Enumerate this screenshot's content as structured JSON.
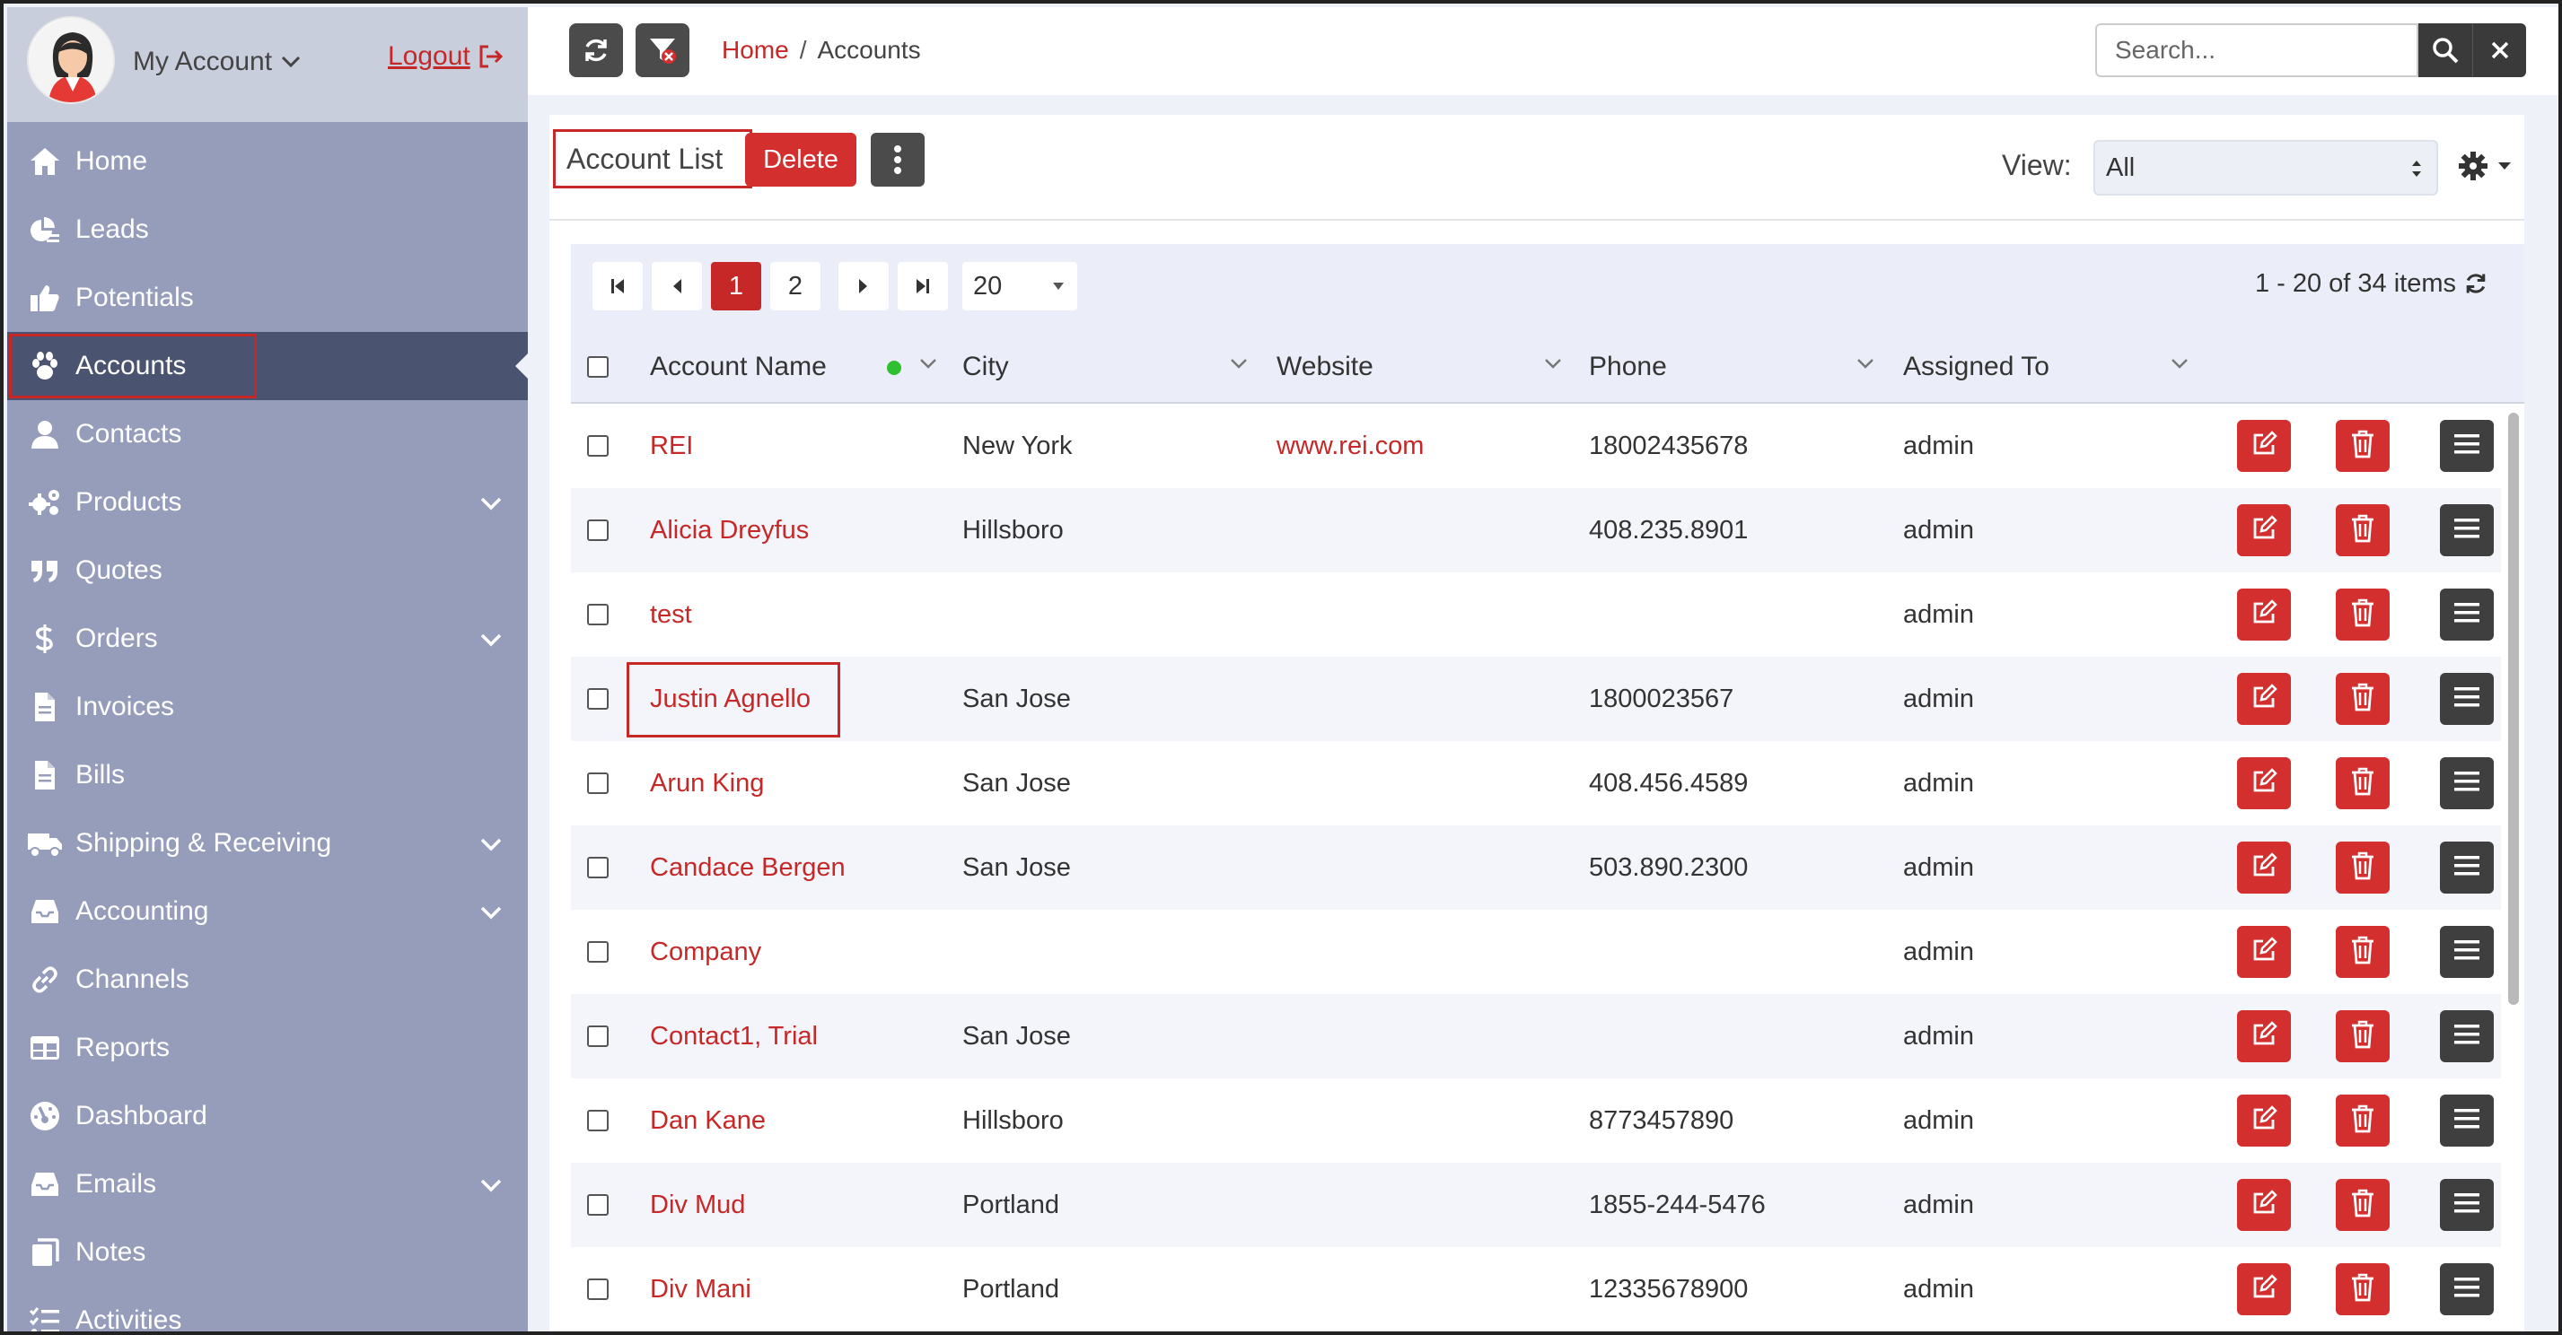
{
  "account_menu": {
    "label": "My Account",
    "logout": "Logout"
  },
  "sidebar": {
    "items": [
      {
        "label": "Home",
        "icon": "home-icon",
        "expandable": false
      },
      {
        "label": "Leads",
        "icon": "leads-icon",
        "expandable": false
      },
      {
        "label": "Potentials",
        "icon": "thumbs-up-icon",
        "expandable": false
      },
      {
        "label": "Accounts",
        "icon": "paw-icon",
        "expandable": false,
        "active": true
      },
      {
        "label": "Contacts",
        "icon": "user-icon",
        "expandable": false
      },
      {
        "label": "Products",
        "icon": "gears-icon",
        "expandable": true
      },
      {
        "label": "Quotes",
        "icon": "quote-icon",
        "expandable": false
      },
      {
        "label": "Orders",
        "icon": "dollar-icon",
        "expandable": true
      },
      {
        "label": "Invoices",
        "icon": "file-icon",
        "expandable": false
      },
      {
        "label": "Bills",
        "icon": "file-icon",
        "expandable": false
      },
      {
        "label": "Shipping & Receiving",
        "icon": "truck-icon",
        "expandable": true
      },
      {
        "label": "Accounting",
        "icon": "inbox-icon",
        "expandable": true
      },
      {
        "label": "Channels",
        "icon": "link-icon",
        "expandable": false
      },
      {
        "label": "Reports",
        "icon": "table-icon",
        "expandable": false
      },
      {
        "label": "Dashboard",
        "icon": "gauge-icon",
        "expandable": false
      },
      {
        "label": "Emails",
        "icon": "inbox-icon",
        "expandable": true
      },
      {
        "label": "Notes",
        "icon": "notes-icon",
        "expandable": false
      },
      {
        "label": "Activities",
        "icon": "tasks-icon",
        "expandable": false
      }
    ]
  },
  "topbar": {
    "breadcrumb_home": "Home",
    "breadcrumb_sep": "/",
    "breadcrumb_current": "Accounts",
    "search_placeholder": "Search...",
    "search_value": ""
  },
  "list": {
    "title": "Account List",
    "delete_label": "Delete",
    "view_label": "View:",
    "view_value": "All"
  },
  "pager": {
    "pages": [
      "1",
      "2"
    ],
    "current_page": "1",
    "page_size": "20",
    "items_info": "1 - 20 of 34 items"
  },
  "table": {
    "columns": [
      "Account Name",
      "City",
      "Website",
      "Phone",
      "Assigned To"
    ],
    "rows": [
      {
        "name": "REI",
        "city": "New York",
        "website": "www.rei.com",
        "phone": "18002435678",
        "assigned": "admin"
      },
      {
        "name": "Alicia Dreyfus",
        "city": "Hillsboro",
        "website": "",
        "phone": "408.235.8901",
        "assigned": "admin"
      },
      {
        "name": "test",
        "city": "",
        "website": "",
        "phone": "",
        "assigned": "admin"
      },
      {
        "name": "Justin Agnello",
        "city": "San Jose",
        "website": "",
        "phone": "1800023567",
        "assigned": "admin"
      },
      {
        "name": "Arun King",
        "city": "San Jose",
        "website": "",
        "phone": "408.456.4589",
        "assigned": "admin"
      },
      {
        "name": "Candace Bergen",
        "city": "San Jose",
        "website": "",
        "phone": "503.890.2300",
        "assigned": "admin"
      },
      {
        "name": "Company",
        "city": "",
        "website": "",
        "phone": "",
        "assigned": "admin"
      },
      {
        "name": "Contact1, Trial",
        "city": "San Jose",
        "website": "",
        "phone": "",
        "assigned": "admin"
      },
      {
        "name": "Dan Kane",
        "city": "Hillsboro",
        "website": "",
        "phone": "8773457890",
        "assigned": "admin"
      },
      {
        "name": "Div Mud",
        "city": "Portland",
        "website": "",
        "phone": "1855-244-5476",
        "assigned": "admin"
      },
      {
        "name": "Div Mani",
        "city": "Portland",
        "website": "",
        "phone": "12335678900",
        "assigned": "admin"
      }
    ]
  },
  "colors": {
    "accent": "#c62828",
    "sidebar_bg": "#959dbb",
    "sidebar_active": "#4a5370",
    "dark_button": "#3f3f3f",
    "status_dot": "#2ec02e"
  }
}
